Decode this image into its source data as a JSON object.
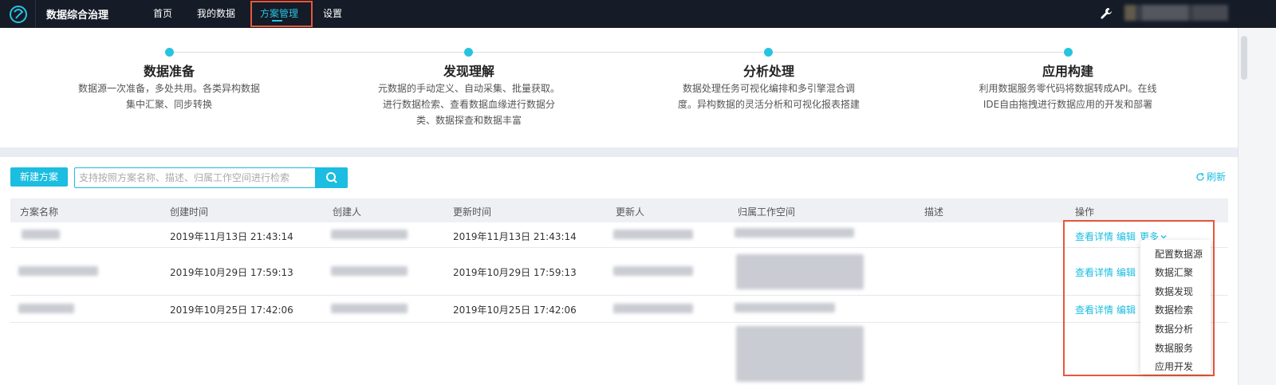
{
  "topbar": {
    "app_title": "数据综合治理",
    "nav": [
      "首页",
      "我的数据",
      "方案管理",
      "设置"
    ],
    "active_nav": "方案管理"
  },
  "steps": [
    {
      "title": "数据准备",
      "desc": [
        "数据源一次准备，多处共用。各类异构数据",
        "集中汇聚、同步转换"
      ]
    },
    {
      "title": "发现理解",
      "desc": [
        "元数据的手动定义、自动采集、批量获取。",
        "进行数据检索、查看数据血缘进行数据分",
        "类、数据探查和数据丰富"
      ]
    },
    {
      "title": "分析处理",
      "desc": [
        "数据处理任务可视化编排和多引擎混合调",
        "度。异构数据的灵活分析和可视化报表搭建"
      ]
    },
    {
      "title": "应用构建",
      "desc": [
        "利用数据服务零代码将数据转成API。在线",
        "IDE自由拖拽进行数据应用的开发和部署"
      ]
    }
  ],
  "toolbar": {
    "new_button": "新建方案",
    "search_placeholder": "支持按照方案名称、描述、归属工作空间进行检索",
    "refresh": "刷新"
  },
  "table": {
    "columns": [
      "方案名称",
      "创建时间",
      "创建人",
      "更新时间",
      "更新人",
      "归属工作空间",
      "描述",
      "操作"
    ],
    "rows": [
      {
        "created": "2019年11月13日 21:43:14",
        "updated": "2019年11月13日 21:43:14"
      },
      {
        "created": "2019年10月29日 17:59:13",
        "updated": "2019年10月29日 17:59:13"
      },
      {
        "created": "2019年10月25日 17:42:06",
        "updated": "2019年10月25日 17:42:06"
      }
    ],
    "actions": {
      "view": "查看详情",
      "edit": "编辑",
      "more": "更多"
    }
  },
  "more_menu": [
    "配置数据源",
    "数据汇聚",
    "数据发现",
    "数据检索",
    "数据分析",
    "数据服务",
    "应用开发"
  ],
  "colors": {
    "accent": "#1bbde0",
    "topbar": "#151b27",
    "highlight": "#e8573a"
  }
}
